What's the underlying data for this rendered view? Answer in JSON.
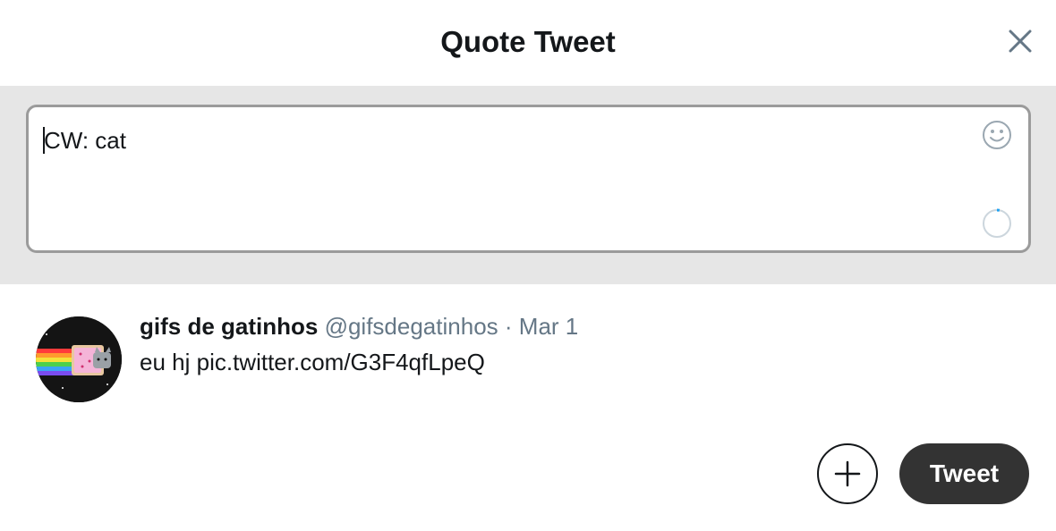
{
  "dialog": {
    "title": "Quote Tweet",
    "close_icon": "close-icon"
  },
  "composer": {
    "text": "CW: cat",
    "emoji_icon": "emoji-icon",
    "counter_icon": "character-counter-ring",
    "counter_progress": 0.03,
    "accent_color": "#1da1f2"
  },
  "quoted_tweet": {
    "author_name": "gifs de gatinhos",
    "handle": "@gifsdegatinhos",
    "separator": "·",
    "date": "Mar 1",
    "text": "eu hj pic.twitter.com/G3F4qfLpeQ",
    "avatar_icon": "nyan-cat-avatar"
  },
  "actions": {
    "add_icon": "plus-icon",
    "tweet_label": "Tweet",
    "tweet_button_color": "#333333"
  }
}
